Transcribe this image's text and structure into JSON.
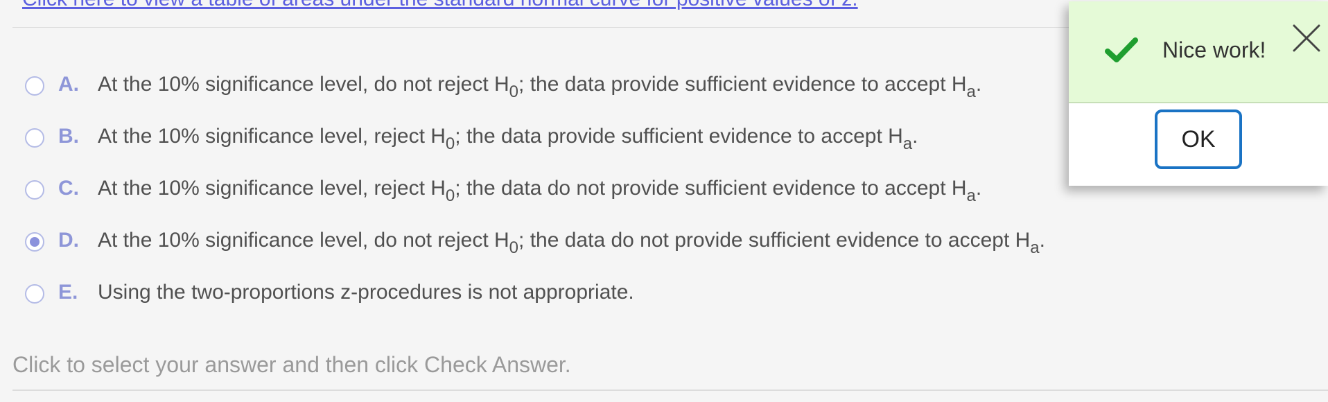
{
  "top_link": {
    "text": "Click here to view a table of areas under the standard normal curve for positive values of z."
  },
  "options": [
    {
      "letter": "A.",
      "selected": false,
      "parts": [
        "At the 10% significance level, do not reject H",
        "0",
        "; the data provide sufficient evidence to accept H",
        "a",
        "."
      ]
    },
    {
      "letter": "B.",
      "selected": false,
      "parts": [
        "At the 10% significance level, reject H",
        "0",
        "; the data provide sufficient evidence to accept H",
        "a",
        "."
      ]
    },
    {
      "letter": "C.",
      "selected": false,
      "parts": [
        "At the 10% significance level, reject H",
        "0",
        "; the data do not provide sufficient evidence to accept H",
        "a",
        "."
      ]
    },
    {
      "letter": "D.",
      "selected": true,
      "parts": [
        "At the 10% significance level, do not reject H",
        "0",
        "; the data do not provide sufficient evidence to accept H",
        "a",
        "."
      ]
    },
    {
      "letter": "E.",
      "selected": false,
      "text": "Using the two-proportions z-procedures is not appropriate."
    }
  ],
  "instruction": "Click to select your answer and then click Check Answer.",
  "popup": {
    "message": "Nice work!",
    "ok_label": "OK",
    "check_icon": "check-icon",
    "close_icon": "close-icon"
  },
  "colors": {
    "link": "#5c60e0",
    "option_letter": "#8e96d8",
    "radio_selected": "#8b92dc",
    "success_bg": "#e5fad7",
    "success_check": "#1f9e2f",
    "ok_border": "#1a73c4"
  }
}
